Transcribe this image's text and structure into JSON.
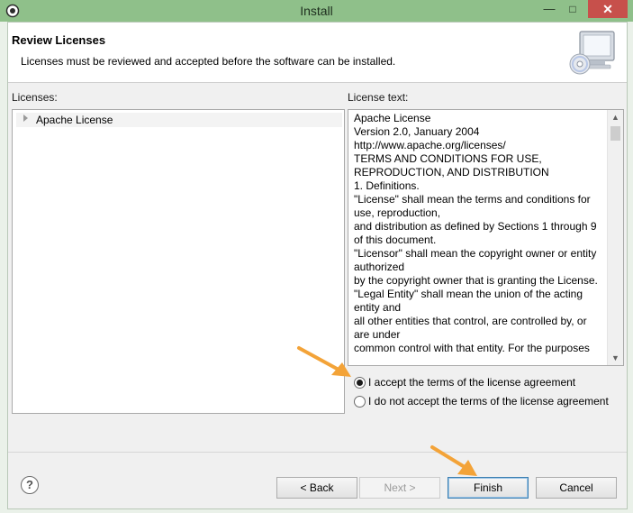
{
  "window": {
    "title": "Install",
    "minimize": "—",
    "close": "✕",
    "title_color": "#8fc08a",
    "close_color": "#c7504b"
  },
  "banner": {
    "title": "Review Licenses",
    "description": "Licenses must be reviewed and accepted before the software can be installed.",
    "image_icon": "monitor-cd-icon"
  },
  "licenses": {
    "label": "Licenses:",
    "items": [
      {
        "label": "Apache License",
        "expanded": false
      }
    ]
  },
  "license_text": {
    "label": "License text:",
    "lines": [
      "Apache License",
      "Version 2.0, January 2004",
      "http://www.apache.org/licenses/",
      "TERMS AND CONDITIONS FOR USE,",
      "REPRODUCTION, AND DISTRIBUTION",
      "1. Definitions.",
      "\"License\" shall mean the terms and conditions for",
      "use, reproduction,",
      "and distribution as defined by Sections 1 through 9",
      "of this document.",
      "\"Licensor\" shall mean the copyright owner or entity",
      "authorized",
      "by the copyright owner that is granting the License.",
      "\"Legal Entity\" shall mean the union of the acting",
      "entity and",
      "all other entities that control, are controlled by, or",
      "are under",
      "common control with that entity. For the purposes"
    ]
  },
  "agreement": {
    "accept_label": "I accept the terms of the license agreement",
    "decline_label": "I do not accept the terms of the license agreement",
    "selected": "accept"
  },
  "buttons": {
    "help_icon": "?",
    "back": "< Back",
    "next": "Next >",
    "finish": "Finish",
    "cancel": "Cancel"
  },
  "annotation_color": "#f3a338"
}
